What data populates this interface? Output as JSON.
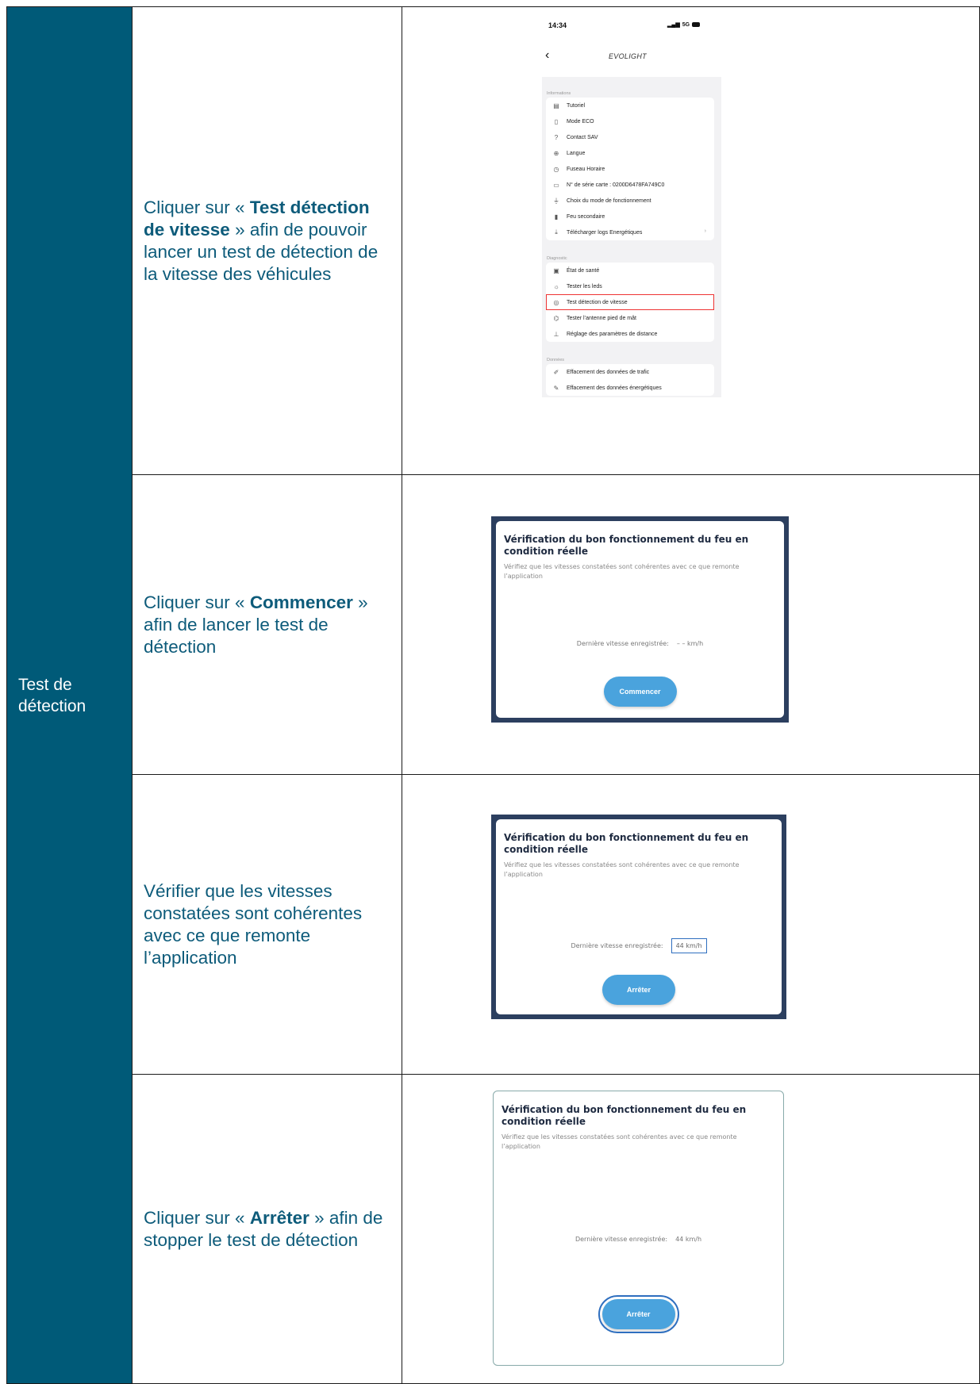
{
  "section": "Test de détection",
  "steps": [
    {
      "prefix": "Cliquer sur « ",
      "keyword": "Test détection de vitesse",
      "suffix": " » afin de pouvoir lancer un test de détection de la vitesse des véhicules"
    },
    {
      "prefix": "Cliquer sur « ",
      "keyword": "Commencer",
      "suffix": " » afin de lancer le test de détection"
    },
    {
      "text": "Vérifier que les vitesses constatées sont cohérentes avec ce que remonte l’application"
    },
    {
      "prefix": "Cliquer sur « ",
      "keyword": "Arrêter",
      "suffix": " » afin de stopper le test de détection"
    }
  ],
  "phone": {
    "time": "14:34",
    "network": "5G",
    "app_title": "EVOLIGHT",
    "groups": [
      {
        "title": "Informations",
        "items": [
          {
            "icon": "book-icon",
            "glyph": "▤",
            "label": "Tutoriel"
          },
          {
            "icon": "battery-icon",
            "glyph": "▯",
            "label": "Mode ECO"
          },
          {
            "icon": "help-icon",
            "glyph": "?",
            "label": "Contact SAV"
          },
          {
            "icon": "globe-icon",
            "glyph": "⊕",
            "label": "Langue"
          },
          {
            "icon": "clock-icon",
            "glyph": "◷",
            "label": "Fuseau Horaire"
          },
          {
            "icon": "laptop-icon",
            "glyph": "▭",
            "label": "N° de série carte : 0200D6478FA749C0"
          },
          {
            "icon": "plug-icon",
            "glyph": "⏚",
            "label": "Choix du mode de fonctionnement"
          },
          {
            "icon": "traffic-light-icon",
            "glyph": "▮",
            "label": "Feu secondaire"
          },
          {
            "icon": "download-icon",
            "glyph": "⤓",
            "label": "Télécharger logs Energétiques",
            "chevron": true
          }
        ]
      },
      {
        "title": "Diagnostic",
        "items": [
          {
            "icon": "health-icon",
            "glyph": "▣",
            "label": "État de santé"
          },
          {
            "icon": "sun-icon",
            "glyph": "☼",
            "label": "Tester les leds"
          },
          {
            "icon": "radar-icon",
            "glyph": "◎",
            "label": "Test détection de vitesse",
            "highlight": true
          },
          {
            "icon": "antenna-icon",
            "glyph": "⌬",
            "label": "Tester l’antenne pied de mât"
          },
          {
            "icon": "distance-icon",
            "glyph": "⊥",
            "label": "Réglage des paramètres de distance"
          }
        ]
      },
      {
        "title": "Données",
        "items": [
          {
            "icon": "erase-icon",
            "glyph": "✐",
            "label": "Effacement des données de trafic"
          },
          {
            "icon": "erase-energy-icon",
            "glyph": "✎",
            "label": "Effacement des données énergétiques"
          }
        ]
      }
    ]
  },
  "dialogs": [
    {
      "title": "Vérification du bon fonctionnement du feu en condition réelle",
      "description": "Vérifiez que les vitesses constatées sont cohérentes avec ce que remonte l’application",
      "speed_label": "Dernière vitesse enregistrée:",
      "speed_value": "– – km/h",
      "button": "Commencer",
      "value_boxed": false,
      "button_outlined": false
    },
    {
      "title": "Vérification du bon fonctionnement du feu en condition réelle",
      "description": "Vérifiez que les vitesses constatées sont cohérentes avec ce que remonte l’application",
      "speed_label": "Dernière vitesse enregistrée:",
      "speed_value": "44 km/h",
      "button": "Arrêter",
      "value_boxed": true,
      "button_outlined": false
    },
    {
      "title": "Vérification du bon fonctionnement du feu en condition réelle",
      "description": "Vérifiez que les vitesses constatées sont cohérentes avec ce que remonte l’application",
      "speed_label": "Dernière vitesse enregistrée:",
      "speed_value": "44 km/h",
      "button": "Arrêter",
      "value_boxed": false,
      "button_outlined": true
    }
  ]
}
